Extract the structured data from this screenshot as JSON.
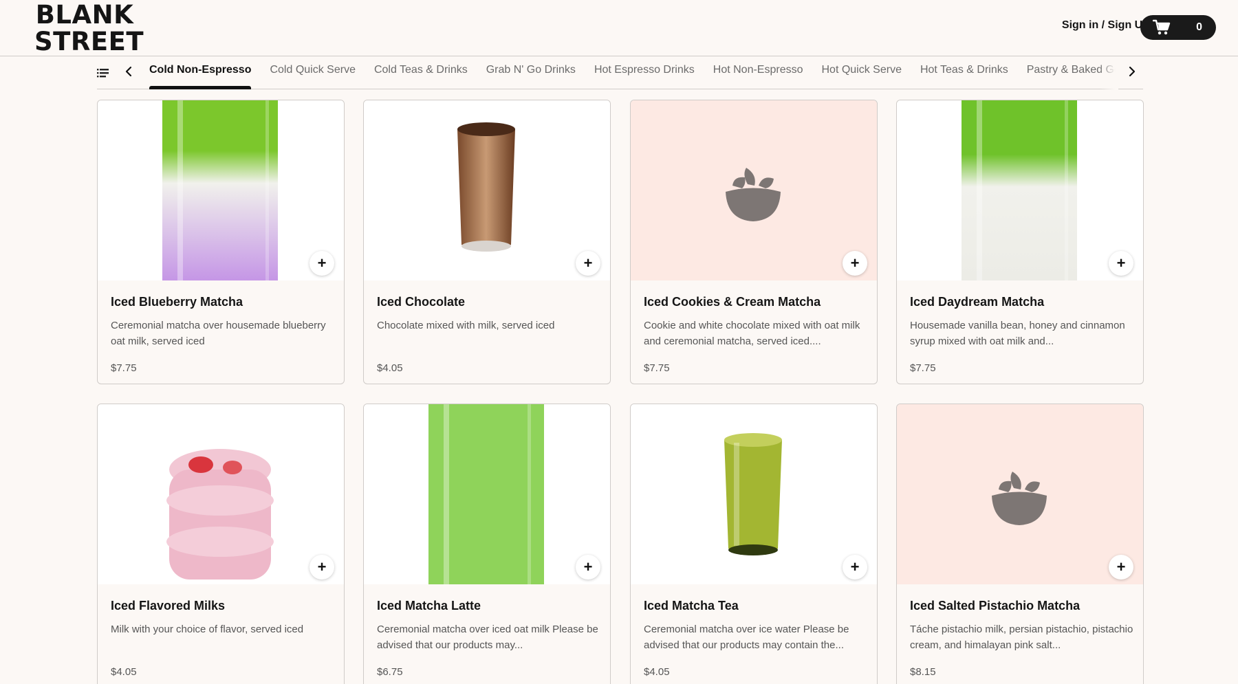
{
  "brand": {
    "line1": "BLANK",
    "line2": "STREET"
  },
  "header": {
    "signin_label": "Sign in / Sign Up",
    "cart_count": "0"
  },
  "nav": {
    "tabs": [
      {
        "label": "Cold Non-Espresso",
        "active": true
      },
      {
        "label": "Cold Quick Serve"
      },
      {
        "label": "Cold Teas & Drinks"
      },
      {
        "label": "Grab N' Go Drinks"
      },
      {
        "label": "Hot Espresso Drinks"
      },
      {
        "label": "Hot Non-Espresso"
      },
      {
        "label": "Hot Quick Serve"
      },
      {
        "label": "Hot Teas & Drinks"
      },
      {
        "label": "Pastry & Baked Go"
      }
    ]
  },
  "products": [
    {
      "name": "Iced Blueberry Matcha",
      "desc": "Ceremonial matcha over housemade blueberry oat milk, served iced",
      "price": "$7.75",
      "image": "blueberry-matcha-drink"
    },
    {
      "name": "Iced Chocolate",
      "desc": "Chocolate mixed with milk, served iced",
      "price": "$4.05",
      "image": "iced-chocolate-drink"
    },
    {
      "name": "Iced Cookies & Cream Matcha",
      "desc": "Cookie and white chocolate mixed with oat milk and ceremonial matcha, served iced....",
      "price": "$7.75",
      "image": "bowl-placeholder-icon"
    },
    {
      "name": "Iced Daydream Matcha",
      "desc": "Housemade vanilla bean, honey and cinnamon syrup mixed with oat milk and...",
      "price": "$7.75",
      "image": "daydream-matcha-drink"
    },
    {
      "name": "Iced Flavored Milks",
      "desc": "Milk with your choice of flavor, served iced",
      "price": "$4.05",
      "image": "strawberry-milk-drink"
    },
    {
      "name": "Iced Matcha Latte",
      "desc": "Ceremonial matcha over iced oat milk Please be advised that our products may...",
      "price": "$6.75",
      "image": "matcha-latte-drink"
    },
    {
      "name": "Iced Matcha Tea",
      "desc": "Ceremonial matcha over ice water Please be advised that our products may contain the...",
      "price": "$4.05",
      "image": "matcha-tea-drink"
    },
    {
      "name": "Iced Salted Pistachio Matcha",
      "desc": "Táche pistachio milk, persian pistachio, pistachio cream, and himalayan pink salt...",
      "price": "$8.15",
      "image": "bowl-placeholder-icon"
    }
  ]
}
